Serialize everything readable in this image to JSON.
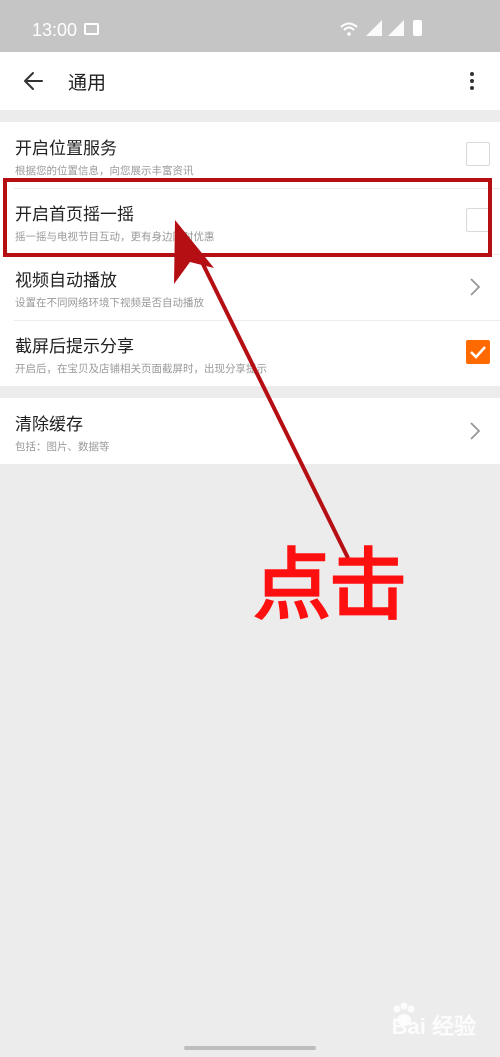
{
  "status_bar": {
    "time": "13:00"
  },
  "header": {
    "title": "通用"
  },
  "settings": {
    "section1": [
      {
        "title": "开启位置服务",
        "subtitle": "根据您的位置信息，向您展示丰富资讯",
        "control": "checkbox",
        "checked": false
      },
      {
        "title": "开启首页摇一摇",
        "subtitle": "摇一摇与电视节目互动，更有身边限时优惠",
        "control": "checkbox",
        "checked": false
      },
      {
        "title": "视频自动播放",
        "subtitle": "设置在不同网络环境下视频是否自动播放",
        "control": "chevron"
      },
      {
        "title": "截屏后提示分享",
        "subtitle": "开启后，在宝贝及店铺相关页面截屏时，出现分享提示",
        "control": "checkbox",
        "checked": true
      }
    ],
    "section2": [
      {
        "title": "清除缓存",
        "subtitle": "包括：图片、数据等",
        "control": "chevron"
      }
    ]
  },
  "annotation": {
    "text": "点击",
    "color": "#ff1010",
    "highlight_color": "#b50f14"
  },
  "watermark": {
    "text": "Bai 经验"
  },
  "colors": {
    "accent": "#ff6a00",
    "background": "#ececec",
    "status_bar": "#c5c5c5"
  }
}
